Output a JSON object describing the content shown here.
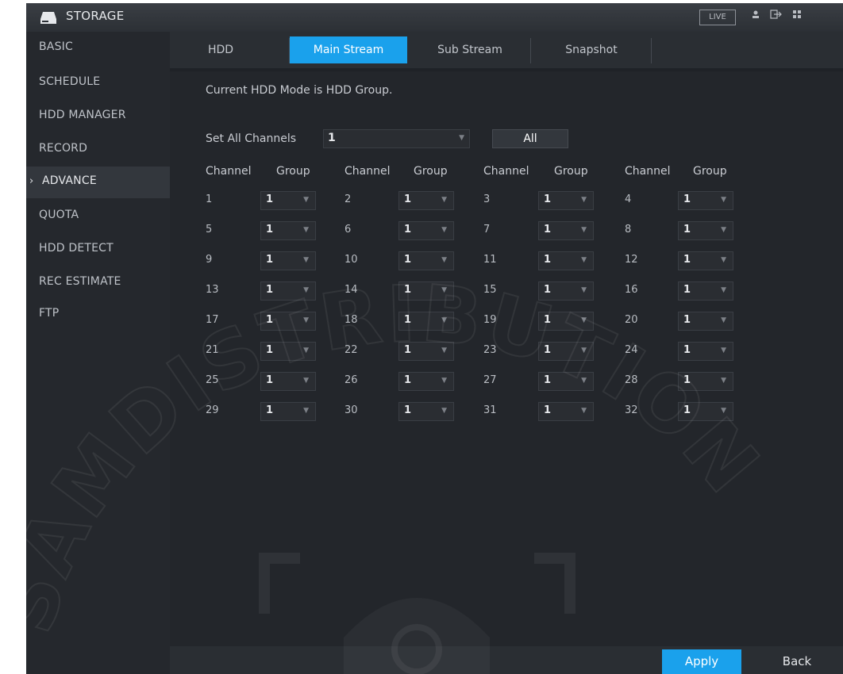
{
  "app": {
    "title": "STORAGE",
    "live_label": "LIVE"
  },
  "topbar": {
    "icons": [
      "user-icon",
      "logout-icon",
      "grid-icon"
    ]
  },
  "sidebar": {
    "items": [
      {
        "label": "BASIC"
      },
      {
        "label": "SCHEDULE"
      },
      {
        "label": "HDD MANAGER"
      },
      {
        "label": "RECORD"
      },
      {
        "label": "ADVANCE",
        "active": true
      },
      {
        "label": "QUOTA"
      },
      {
        "label": "HDD DETECT"
      },
      {
        "label": "REC ESTIMATE"
      },
      {
        "label": "FTP"
      }
    ]
  },
  "tabs": [
    {
      "label": "HDD"
    },
    {
      "label": "Main Stream",
      "active": true
    },
    {
      "label": "Sub Stream"
    },
    {
      "label": "Snapshot"
    }
  ],
  "content": {
    "hdd_mode_text": "Current HDD Mode is HDD Group.",
    "set_all_label": "Set All Channels",
    "set_all_value": "1",
    "all_button": "All",
    "channel_header": "Channel",
    "group_header": "Group",
    "channels": [
      {
        "ch": "1",
        "group": "1"
      },
      {
        "ch": "2",
        "group": "1"
      },
      {
        "ch": "3",
        "group": "1"
      },
      {
        "ch": "4",
        "group": "1"
      },
      {
        "ch": "5",
        "group": "1"
      },
      {
        "ch": "6",
        "group": "1"
      },
      {
        "ch": "7",
        "group": "1"
      },
      {
        "ch": "8",
        "group": "1"
      },
      {
        "ch": "9",
        "group": "1"
      },
      {
        "ch": "10",
        "group": "1"
      },
      {
        "ch": "11",
        "group": "1"
      },
      {
        "ch": "12",
        "group": "1"
      },
      {
        "ch": "13",
        "group": "1"
      },
      {
        "ch": "14",
        "group": "1"
      },
      {
        "ch": "15",
        "group": "1"
      },
      {
        "ch": "16",
        "group": "1"
      },
      {
        "ch": "17",
        "group": "1"
      },
      {
        "ch": "18",
        "group": "1"
      },
      {
        "ch": "19",
        "group": "1"
      },
      {
        "ch": "20",
        "group": "1"
      },
      {
        "ch": "21",
        "group": "1"
      },
      {
        "ch": "22",
        "group": "1"
      },
      {
        "ch": "23",
        "group": "1"
      },
      {
        "ch": "24",
        "group": "1"
      },
      {
        "ch": "25",
        "group": "1"
      },
      {
        "ch": "26",
        "group": "1"
      },
      {
        "ch": "27",
        "group": "1"
      },
      {
        "ch": "28",
        "group": "1"
      },
      {
        "ch": "29",
        "group": "1"
      },
      {
        "ch": "30",
        "group": "1"
      },
      {
        "ch": "31",
        "group": "1"
      },
      {
        "ch": "32",
        "group": "1"
      }
    ]
  },
  "footer": {
    "apply_label": "Apply",
    "back_label": "Back"
  },
  "watermark": {
    "text": "SAMDISTRIBUTION"
  },
  "colors": {
    "accent": "#1aa1ec",
    "background": "#1f2227",
    "sidebar": "#25282d"
  }
}
